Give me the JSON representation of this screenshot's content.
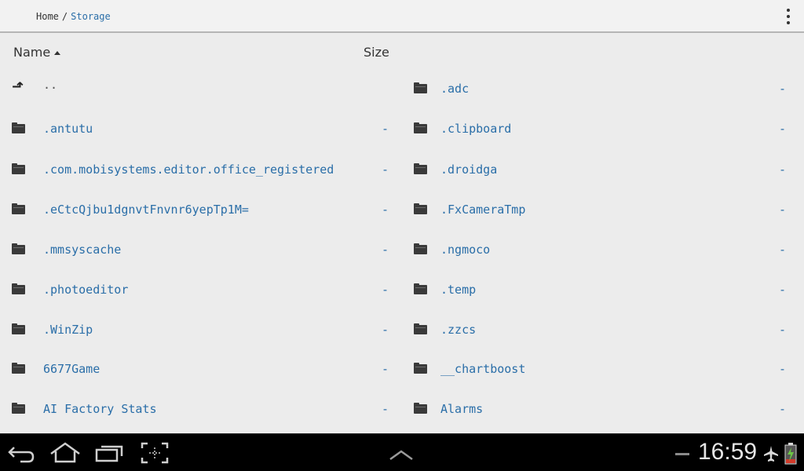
{
  "breadcrumb": {
    "home": "Home",
    "separator": "/",
    "current": "Storage"
  },
  "header": {
    "name_label": "Name",
    "size_label": "Size",
    "sort": "ascending"
  },
  "rows": [
    {
      "left": {
        "icon": "up-arrow-icon",
        "name": "..",
        "size": ""
      },
      "right": {
        "icon": "folder-icon",
        "name": ".adc",
        "size": "-"
      }
    },
    {
      "left": {
        "icon": "folder-icon",
        "name": ".antutu",
        "size": "-"
      },
      "right": {
        "icon": "folder-icon",
        "name": ".clipboard",
        "size": "-"
      }
    },
    {
      "left": {
        "icon": "folder-icon",
        "name": ".com.mobisystems.editor.office_registered",
        "size": "-"
      },
      "right": {
        "icon": "folder-icon",
        "name": ".droidga",
        "size": "-"
      }
    },
    {
      "left": {
        "icon": "folder-icon",
        "name": ".eCtcQjbu1dgnvtFnvnr6yepTp1M=",
        "size": "-"
      },
      "right": {
        "icon": "folder-icon",
        "name": ".FxCameraTmp",
        "size": "-"
      }
    },
    {
      "left": {
        "icon": "folder-icon",
        "name": ".mmsyscache",
        "size": "-"
      },
      "right": {
        "icon": "folder-icon",
        "name": ".ngmoco",
        "size": "-"
      }
    },
    {
      "left": {
        "icon": "folder-icon",
        "name": ".photoeditor",
        "size": "-"
      },
      "right": {
        "icon": "folder-icon",
        "name": ".temp",
        "size": "-"
      }
    },
    {
      "left": {
        "icon": "folder-icon",
        "name": ".WinZip",
        "size": "-"
      },
      "right": {
        "icon": "folder-icon",
        "name": ".zzcs",
        "size": "-"
      }
    },
    {
      "left": {
        "icon": "folder-icon",
        "name": "6677Game",
        "size": "-"
      },
      "right": {
        "icon": "folder-icon",
        "name": "__chartboost",
        "size": "-"
      }
    },
    {
      "left": {
        "icon": "folder-icon",
        "name": "AI Factory Stats",
        "size": "-"
      },
      "right": {
        "icon": "folder-icon",
        "name": "Alarms",
        "size": "-"
      }
    }
  ],
  "status": {
    "time": "16:59"
  },
  "colors": {
    "link": "#2a6ea8",
    "background": "#ececec",
    "navbar": "#000000"
  }
}
